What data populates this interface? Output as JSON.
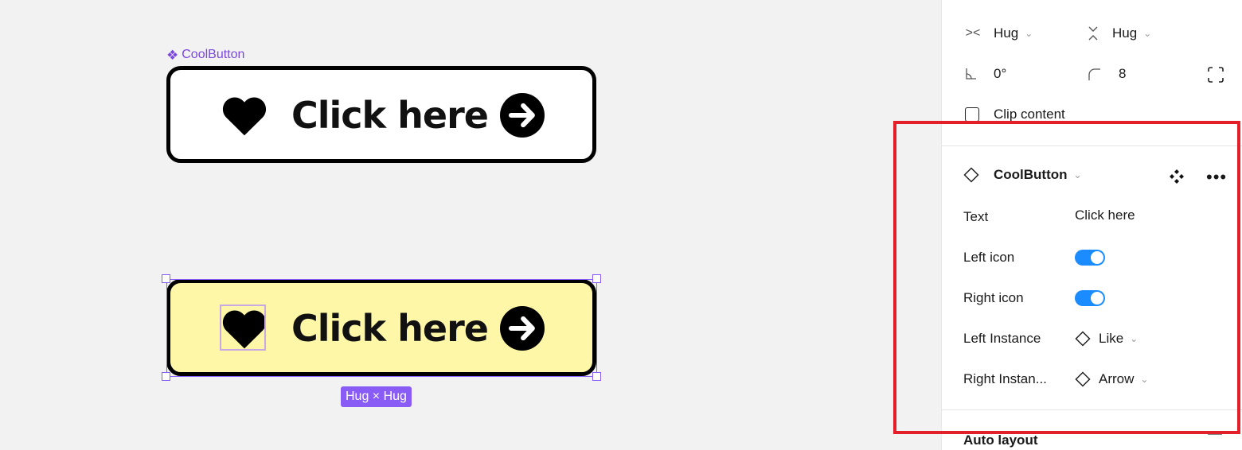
{
  "canvas": {
    "component_label": "CoolButton",
    "component_glyph": "❖",
    "main_component": {
      "text": "Click here",
      "background": "#ffffff",
      "left_icon": "heart-icon",
      "right_icon": "arrow-right-circle-icon"
    },
    "instance": {
      "text": "Click here",
      "background": "#fff7a8",
      "left_icon": "heart-icon",
      "right_icon": "arrow-right-circle-icon",
      "size_badge": "Hug × Hug"
    }
  },
  "panel": {
    "width_mode": "Hug",
    "height_mode": "Hug",
    "rotation": "0°",
    "corner_radius": "8",
    "clip_content_label": "Clip content",
    "clip_content_checked": false,
    "component": {
      "name": "CoolButton",
      "properties": [
        {
          "label": "Text",
          "type": "text",
          "value": "Click here"
        },
        {
          "label": "Left icon",
          "type": "toggle",
          "value": true
        },
        {
          "label": "Right icon",
          "type": "toggle",
          "value": true
        },
        {
          "label": "Left Instance",
          "type": "instance",
          "value": "Like"
        },
        {
          "label": "Right Instan...",
          "type": "instance",
          "value": "Arrow"
        }
      ]
    },
    "auto_layout_label": "Auto layout"
  },
  "colors": {
    "accent_purple": "#8a5cf6",
    "toggle_blue": "#1b8cff",
    "highlight_red": "#e3202a"
  }
}
